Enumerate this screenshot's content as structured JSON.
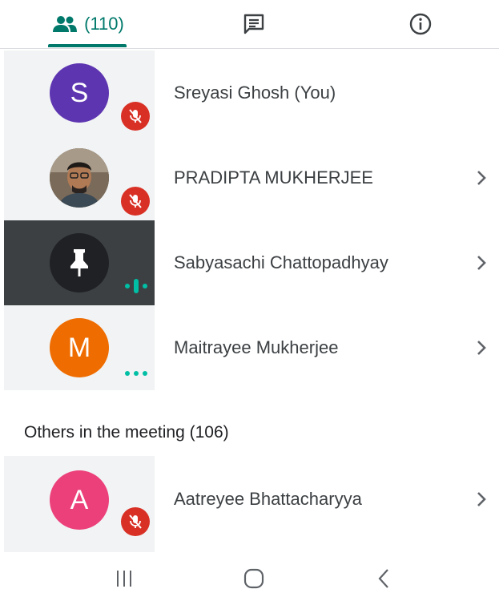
{
  "tabs": {
    "people_count": "(110)",
    "people_icon": "people-icon",
    "chat_icon": "chat-icon",
    "info_icon": "info-icon",
    "accent": "#00796b"
  },
  "participants": [
    {
      "name": "Sreyasi Ghosh (You)",
      "initial": "S",
      "avatar_color": "#5e35b1",
      "status": "muted"
    },
    {
      "name": "PRADIPTA MUKHERJEE",
      "initial": "",
      "avatar_color": "#6d5a4a",
      "status": "muted",
      "avatar": "photo"
    },
    {
      "name": "Sabyasachi Chattopadhyay",
      "initial": "",
      "avatar_color": "#202124",
      "status": "speaking",
      "avatar": "pin-icon"
    },
    {
      "name": "Maitrayee Mukherjee",
      "initial": "M",
      "avatar_color": "#ef6c00",
      "status": "connecting"
    }
  ],
  "others_section": {
    "title": "Others in the meeting (106)"
  },
  "others": [
    {
      "name": "Aatreyee Bhattacharyya",
      "initial": "A",
      "avatar_color": "#ec407a",
      "status": "muted"
    }
  ],
  "status_colors": {
    "muted": "#d93025",
    "speaking": "#00bfa5"
  }
}
